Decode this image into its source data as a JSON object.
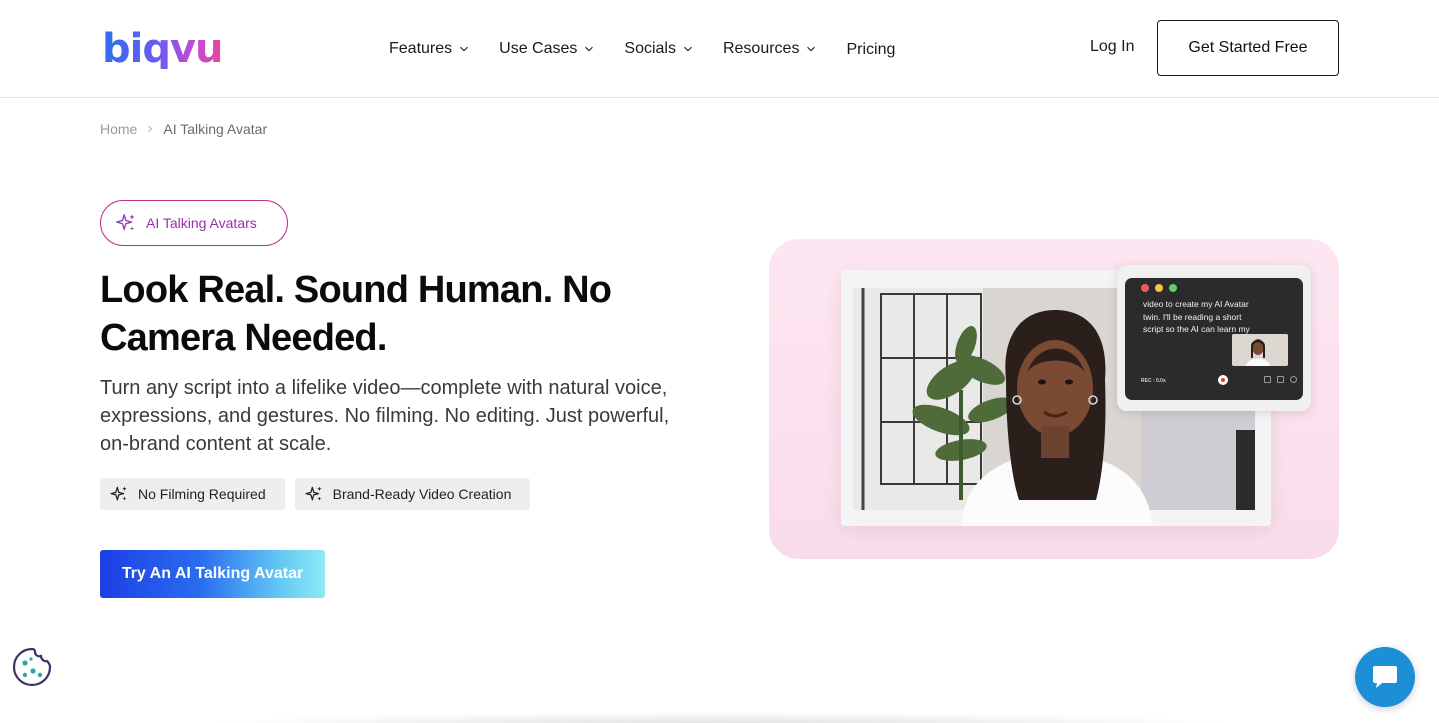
{
  "header": {
    "logo_text": "biqvu",
    "nav": [
      {
        "label": "Features"
      },
      {
        "label": "Use Cases"
      },
      {
        "label": "Socials"
      },
      {
        "label": "Resources"
      },
      {
        "label": "Pricing"
      }
    ],
    "login_label": "Log In",
    "cta_label": "Get Started Free"
  },
  "breadcrumb": {
    "home": "Home",
    "current": "AI Talking Avatar"
  },
  "hero": {
    "badge": "AI Talking Avatars",
    "headline": "Look Real. Sound Human. No Camera Needed.",
    "subtext": "Turn any script into a lifelike video—complete with natural voice, expressions, and gestures. No filming. No editing. Just powerful, on-brand content at scale.",
    "features": [
      {
        "label": "No Filming Required"
      },
      {
        "label": "Brand-Ready Video Creation"
      }
    ],
    "cta_label": "Try An AI Talking Avatar"
  },
  "recorder": {
    "script_text": "video to create my AI Avatar twin. I'll be reading a short script so the AI can learn my",
    "status": "REC : 0.0s"
  },
  "colors": {
    "brand_gradient_start": "#2f6ff0",
    "brand_gradient_end": "#e8479a",
    "badge_border": "#b8338e",
    "cta_blue": "#1d3fe4",
    "cta_cyan": "#8ee9f6",
    "chat_blue": "#1c8fd6",
    "media_pink": "#fde6f1"
  }
}
